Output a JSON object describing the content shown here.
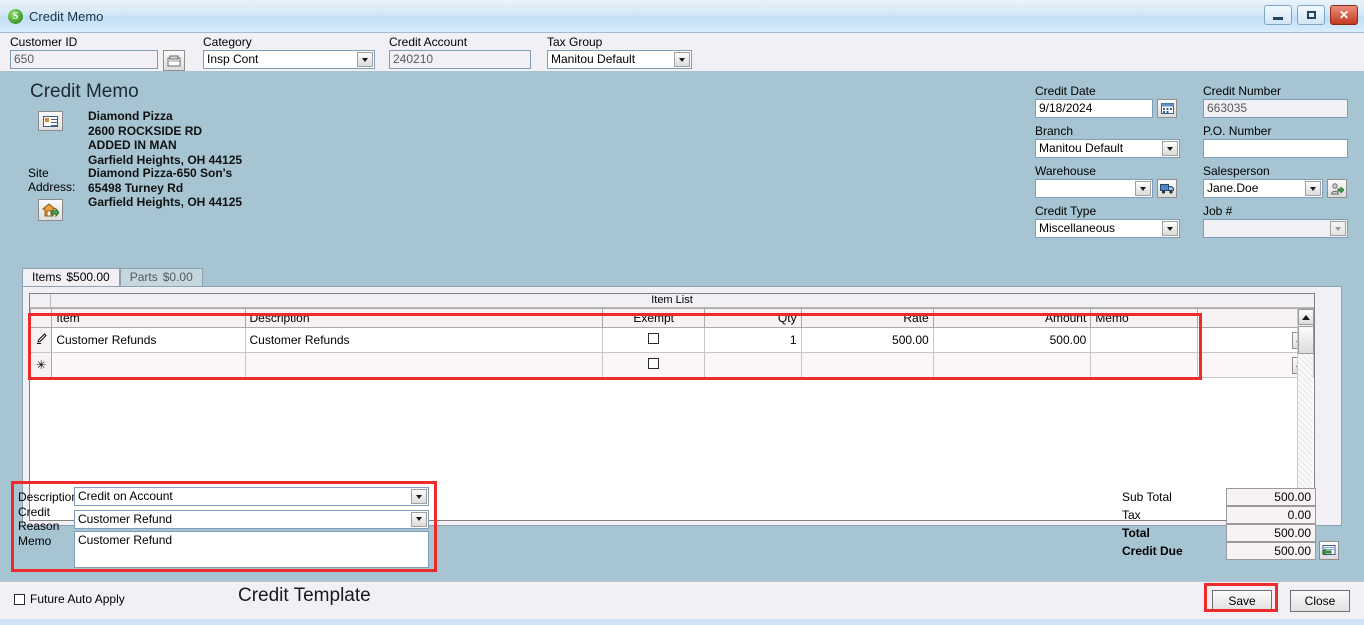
{
  "window": {
    "title": "Credit Memo",
    "app_icon": "S",
    "minimize": "minimize-icon",
    "maximize": "maximize-icon",
    "close": "✕"
  },
  "topstrip": {
    "customer_id": {
      "label_pre": "C",
      "label_accel": "u",
      "label_post": "stomer ID",
      "label": "Customer ID",
      "value": "650",
      "lookup_icon": "customer-lookup-icon"
    },
    "category": {
      "label": "Category",
      "value": "Insp Cont"
    },
    "credit_account": {
      "label": "Credit Account",
      "value": "240210"
    },
    "tax_group": {
      "label": "Tax Group",
      "value": "Manitou Default"
    }
  },
  "form": {
    "title": "Credit Memo",
    "bill_to": {
      "icon": "contact-card-icon",
      "lines": [
        "Diamond Pizza",
        "2600 ROCKSIDE RD",
        "ADDED IN MAN",
        "Garfield Heights, OH  44125"
      ]
    },
    "site": {
      "label_line1": "Site",
      "label_line2": "Address:",
      "icon": "home-icon",
      "lines": [
        "Diamond Pizza-650 Son's",
        "65498 Turney Rd",
        "Garfield Heights, OH  44125"
      ]
    },
    "right_fields": {
      "credit_date": {
        "label": "Credit Date",
        "value": "9/18/2024",
        "button_icon": "calendar-icon"
      },
      "credit_number": {
        "label": "Credit Number",
        "value": "663035"
      },
      "branch": {
        "label": "Branch",
        "value": "Manitou Default"
      },
      "po_number": {
        "label": "P.O. Number",
        "value": ""
      },
      "warehouse": {
        "label": "Warehouse",
        "value": "",
        "button_icon": "truck-icon"
      },
      "salesperson": {
        "label": "Salesperson",
        "value": "Jane.Doe",
        "button_icon": "person-go-icon"
      },
      "credit_type": {
        "label": "Credit Type",
        "value": "Miscellaneous"
      },
      "job_number": {
        "label": "Job #",
        "value": ""
      }
    }
  },
  "tabs": [
    {
      "label": "Items",
      "amount": "$500.00",
      "active": true
    },
    {
      "label": "Parts",
      "amount": "$0.00",
      "active": false
    }
  ],
  "grid": {
    "caption": "Item List",
    "columns": [
      "Item",
      "Description",
      "Exempt",
      "Qty",
      "Rate",
      "Amount",
      "Memo"
    ],
    "rows": [
      {
        "indicator": "edit-pencil-icon",
        "item": "Customer Refunds",
        "description": "Customer Refunds",
        "exempt": false,
        "qty": "1",
        "rate": "500.00",
        "amount": "500.00",
        "memo": "",
        "detail_button": "..."
      },
      {
        "indicator": "new-row-asterisk-icon",
        "item": "",
        "description": "",
        "exempt": false,
        "qty": "",
        "rate": "",
        "amount": "",
        "memo": "",
        "detail_button": "..."
      }
    ],
    "scroll_up": "scroll-up-icon",
    "scroll_down": "scroll-down-icon"
  },
  "description_panel": {
    "description": {
      "label": "Description",
      "value": "Credit on Account"
    },
    "credit_reason": {
      "label": "Credit Reason",
      "value": "Customer Refund"
    },
    "memo": {
      "label": "Memo",
      "value": "Customer Refund "
    }
  },
  "totals": [
    {
      "label": "Sub Total",
      "value": "500.00",
      "bold": false
    },
    {
      "label": "Tax",
      "value": "0.00",
      "bold": false
    },
    {
      "label": "Total",
      "value": "500.00",
      "bold": true
    },
    {
      "label": "Credit Due",
      "value": "500.00",
      "bold": true,
      "button_icon": "apply-credit-icon"
    }
  ],
  "footer": {
    "future_auto_apply": {
      "label": "Future Auto Apply",
      "checked": false
    },
    "save": "Save",
    "close": "Close"
  },
  "annotation": "Credit Template",
  "colors": {
    "form_background": "#a6c4d1",
    "panel_background": "#f2f0f4",
    "highlight_red": "#ee2b2b",
    "titlebar_blue": "#cfe4f5"
  }
}
